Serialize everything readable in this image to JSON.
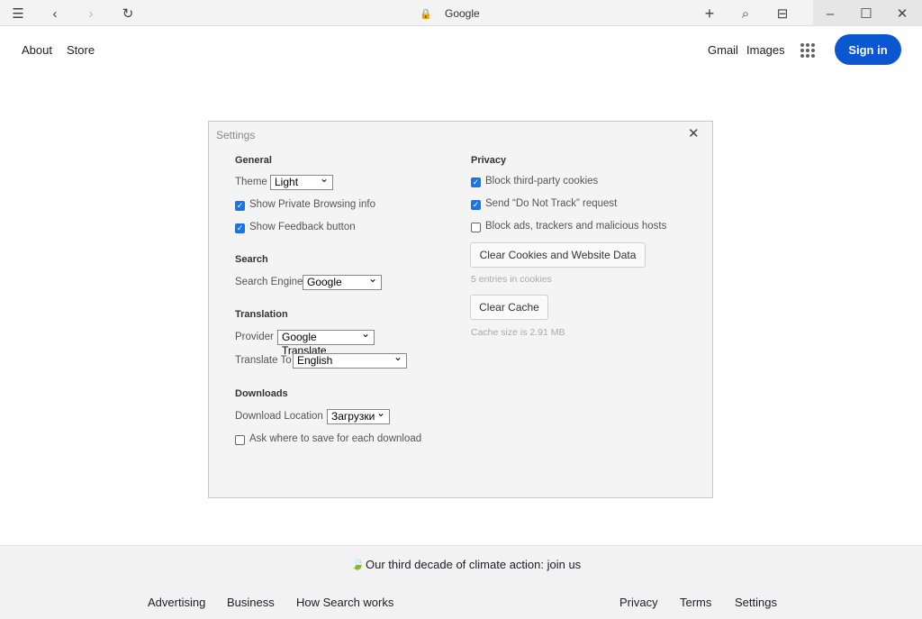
{
  "browser": {
    "title": "Google",
    "icons": [
      "menu-icon",
      "back-icon",
      "forward-icon",
      "reload-icon",
      "lock-icon",
      "new-tab-icon",
      "search-icon",
      "tabs-icon",
      "minimize-icon",
      "maximize-icon",
      "close-icon"
    ]
  },
  "header": {
    "left_links": [
      "About",
      "Store"
    ],
    "right_links": [
      "Gmail",
      "Images"
    ],
    "sign_in": "Sign in",
    "accent": "#0b57d0"
  },
  "settings": {
    "title": "Settings",
    "general": {
      "heading": "General",
      "theme_label": "Theme",
      "theme_value": "Light",
      "show_private": "Show Private Browsing info",
      "show_private_checked": true,
      "show_feedback": "Show Feedback button",
      "show_feedback_checked": true
    },
    "search": {
      "heading": "Search",
      "engine_label": "Search Engine",
      "engine_value": "Google"
    },
    "translation": {
      "heading": "Translation",
      "provider_label": "Provider",
      "provider_value": "Google Translate",
      "to_label": "Translate To",
      "to_value": "English"
    },
    "downloads": {
      "heading": "Downloads",
      "location_label": "Download Location",
      "location_value": "Загрузки",
      "ask": "Ask where to save for each download",
      "ask_checked": false
    },
    "privacy": {
      "heading": "Privacy",
      "block_third": "Block third-party cookies",
      "block_third_checked": true,
      "dnt": "Send “Do Not Track” request",
      "dnt_checked": true,
      "block_ads": "Block ads, trackers and malicious hosts",
      "block_ads_checked": false,
      "clear_cookies": "Clear Cookies and Website Data",
      "cookies_info": "5 entries in cookies",
      "clear_cache": "Clear Cache",
      "cache_info": "Cache size is 2.91 MB"
    }
  },
  "footer": {
    "climate": "Our third decade of climate action: join us",
    "left": [
      "Advertising",
      "Business",
      "How Search works"
    ],
    "right": [
      "Privacy",
      "Terms",
      "Settings"
    ]
  }
}
